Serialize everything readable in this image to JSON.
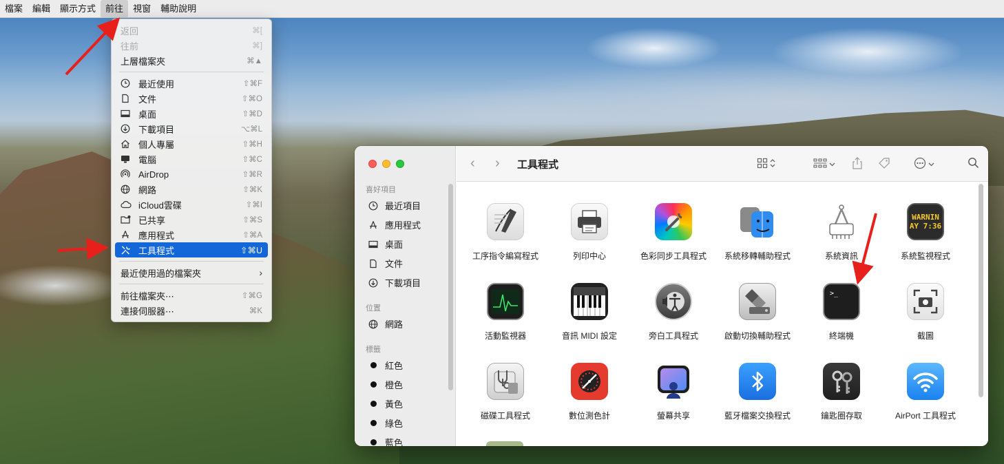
{
  "menubar": {
    "items": [
      "檔案",
      "編輯",
      "顯示方式",
      "前往",
      "視窗",
      "輔助說明"
    ],
    "active": "前往"
  },
  "go_menu": {
    "back": {
      "label": "返回",
      "shortcut": "⌘["
    },
    "forward": {
      "label": "往前",
      "shortcut": "⌘]"
    },
    "enclosing": {
      "label": "上層檔案夾",
      "shortcut": "⌘▲"
    },
    "places": [
      {
        "label": "最近使用",
        "shortcut": "⇧⌘F",
        "icon": "clock-icon"
      },
      {
        "label": "文件",
        "shortcut": "⇧⌘O",
        "icon": "document-icon"
      },
      {
        "label": "桌面",
        "shortcut": "⇧⌘D",
        "icon": "desktop-icon"
      },
      {
        "label": "下載項目",
        "shortcut": "⌥⌘L",
        "icon": "download-icon"
      },
      {
        "label": "個人專屬",
        "shortcut": "⇧⌘H",
        "icon": "home-icon"
      },
      {
        "label": "電腦",
        "shortcut": "⇧⌘C",
        "icon": "computer-icon"
      },
      {
        "label": "AirDrop",
        "shortcut": "⇧⌘R",
        "icon": "airdrop-icon"
      },
      {
        "label": "網路",
        "shortcut": "⇧⌘K",
        "icon": "network-icon"
      },
      {
        "label": "iCloud雲碟",
        "shortcut": "⇧⌘I",
        "icon": "cloud-icon"
      },
      {
        "label": "已共享",
        "shortcut": "⇧⌘S",
        "icon": "shared-folder-icon"
      },
      {
        "label": "應用程式",
        "shortcut": "⇧⌘A",
        "icon": "applications-icon"
      },
      {
        "label": "工具程式",
        "shortcut": "⇧⌘U",
        "icon": "utilities-icon"
      }
    ],
    "recent_folders": "最近使用過的檔案夾",
    "go_to_folder": {
      "label": "前往檔案夾⋯",
      "shortcut": "⇧⌘G"
    },
    "connect_server": {
      "label": "連接伺服器⋯",
      "shortcut": "⌘K"
    }
  },
  "finder": {
    "title": "工具程式",
    "sidebar": {
      "favorites_header": "喜好項目",
      "favorites": [
        "最近項目",
        "應用程式",
        "桌面",
        "文件",
        "下載項目"
      ],
      "locations_header": "位置",
      "locations": [
        "網路"
      ],
      "tags_header": "標籤",
      "tags": [
        "紅色",
        "橙色",
        "黃色",
        "綠色",
        "藍色"
      ]
    },
    "apps": [
      "工序指令編寫程式",
      "列印中心",
      "色彩同步工具程式",
      "系統移轉輔助程式",
      "系統資訊",
      "系統監視程式",
      "活動監視器",
      "音訊 MIDI 設定",
      "旁白工具程式",
      "啟動切換輔助程式",
      "終端機",
      "截圖",
      "磁碟工具程式",
      "數位測色計",
      "螢幕共享",
      "藍牙檔案交換程式",
      "鑰匙圈存取",
      "AirPort 工具程式"
    ],
    "console_icon_text": [
      "WARNIN",
      "AY 7:36"
    ],
    "terminal_prompt": ">_"
  },
  "colors": {
    "selection": "#1467d9",
    "annotation_arrow": "#e8201c"
  }
}
